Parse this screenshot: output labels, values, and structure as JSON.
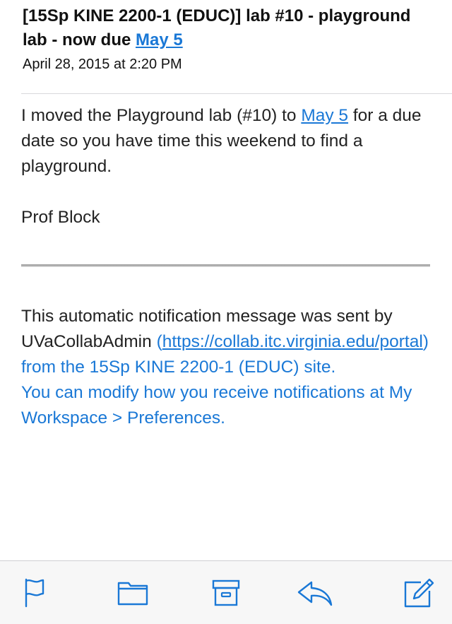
{
  "email": {
    "subject_prefix": "[15Sp KINE 2200-1 (EDUC)] lab #10 - playground lab - now due ",
    "subject_link": "May 5",
    "date": "April 28, 2015 at 2:20 PM",
    "body_before_link": "I moved the Playground lab (#10) to ",
    "body_link": "May 5",
    "body_after_link": " for a due date so you have time this weekend to find a playground.",
    "signature": "Prof Block"
  },
  "footer": {
    "line1": "This automatic notification message was sent by UVaCollabAdmin",
    "paren_open": "(",
    "url": "https://collab.itc.virginia.edu/portal",
    "after_url": ") from the 15Sp KINE 2200-1 (EDUC) site.",
    "preferences_note": "You can modify how you receive notifications at My Workspace > Preferences."
  },
  "toolbar": {
    "icons": [
      "flag-icon",
      "folder-icon",
      "archive-icon",
      "reply-icon",
      "compose-icon"
    ],
    "accent_color": "#1a78d6"
  }
}
